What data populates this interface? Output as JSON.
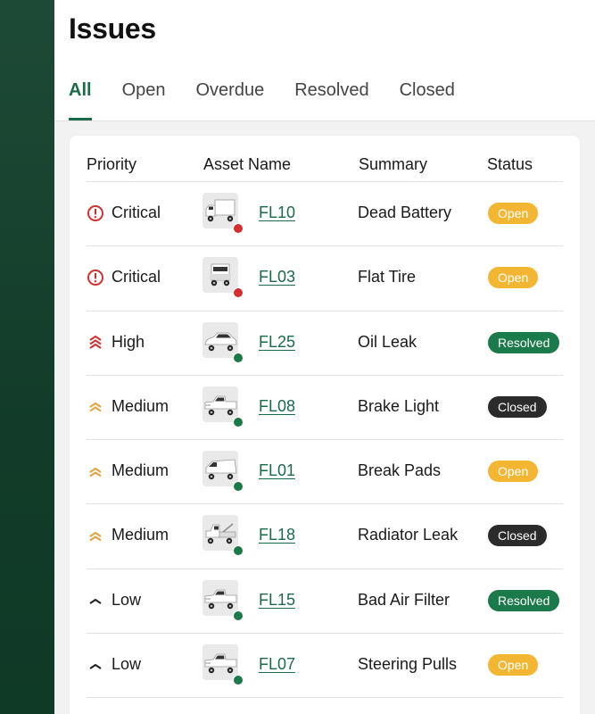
{
  "page": {
    "title": "Issues"
  },
  "tabs": [
    {
      "label": "All",
      "active": true
    },
    {
      "label": "Open",
      "active": false
    },
    {
      "label": "Overdue",
      "active": false
    },
    {
      "label": "Resolved",
      "active": false
    },
    {
      "label": "Closed",
      "active": false
    }
  ],
  "table": {
    "headers": {
      "priority": "Priority",
      "asset": "Asset Name",
      "summary": "Summary",
      "status": "Status"
    },
    "rows": [
      {
        "priority": "Critical",
        "priority_icon": "critical-alert-icon",
        "asset": "FL10",
        "vehicle_icon": "box-truck-icon",
        "dot_color": "#d32f2f",
        "summary": "Dead Battery",
        "status": "Open"
      },
      {
        "priority": "Critical",
        "priority_icon": "critical-alert-icon",
        "asset": "FL03",
        "vehicle_icon": "semi-truck-icon",
        "dot_color": "#d32f2f",
        "summary": "Flat Tire",
        "status": "Open"
      },
      {
        "priority": "High",
        "priority_icon": "triple-chevron-up-icon",
        "asset": "FL25",
        "vehicle_icon": "sedan-icon",
        "dot_color": "#1b7a4a",
        "summary": "Oil Leak",
        "status": "Resolved"
      },
      {
        "priority": "Medium",
        "priority_icon": "double-chevron-up-icon",
        "asset": "FL08",
        "vehicle_icon": "pickup-truck-icon",
        "dot_color": "#1b7a4a",
        "summary": "Brake Light",
        "status": "Closed"
      },
      {
        "priority": "Medium",
        "priority_icon": "double-chevron-up-icon",
        "asset": "FL01",
        "vehicle_icon": "cargo-van-icon",
        "dot_color": "#1b7a4a",
        "summary": "Break Pads",
        "status": "Open"
      },
      {
        "priority": "Medium",
        "priority_icon": "double-chevron-up-icon",
        "asset": "FL18",
        "vehicle_icon": "tow-truck-icon",
        "dot_color": "#1b7a4a",
        "summary": "Radiator Leak",
        "status": "Closed"
      },
      {
        "priority": "Low",
        "priority_icon": "chevron-up-icon",
        "asset": "FL15",
        "vehicle_icon": "pickup-truck-icon",
        "dot_color": "#1b7a4a",
        "summary": "Bad Air Filter",
        "status": "Resolved"
      },
      {
        "priority": "Low",
        "priority_icon": "chevron-up-icon",
        "asset": "FL07",
        "vehicle_icon": "pickup-truck-icon",
        "dot_color": "#1b7a4a",
        "summary": "Steering Pulls",
        "status": "Open"
      }
    ]
  },
  "colors": {
    "brand_green": "#1b6b48",
    "sidebar": "#123c29",
    "critical": "#d32f2f",
    "high": "#d32f2f",
    "medium": "#e6a23c",
    "low": "#222222",
    "status_open": "#f2b632",
    "status_resolved": "#1b7a4a",
    "status_closed": "#2b2b2b"
  }
}
